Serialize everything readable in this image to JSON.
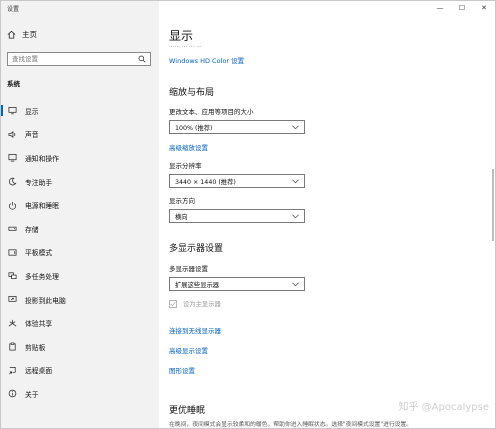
{
  "window": {
    "title": "设置",
    "controls": {
      "minimize": "—",
      "maximize": "☐",
      "close": "✕"
    }
  },
  "sidebar": {
    "home_label": "主页",
    "search_placeholder": "查找设置",
    "section_label": "系统",
    "items": [
      {
        "label": "显示",
        "icon": "monitor-icon"
      },
      {
        "label": "声音",
        "icon": "speaker-icon"
      },
      {
        "label": "通知和操作",
        "icon": "notification-icon"
      },
      {
        "label": "专注助手",
        "icon": "moon-icon"
      },
      {
        "label": "电源和睡眠",
        "icon": "power-icon"
      },
      {
        "label": "存储",
        "icon": "storage-icon"
      },
      {
        "label": "平板模式",
        "icon": "tablet-icon"
      },
      {
        "label": "多任务处理",
        "icon": "multitask-icon"
      },
      {
        "label": "投影到此电脑",
        "icon": "project-icon"
      },
      {
        "label": "体验共享",
        "icon": "share-icon"
      },
      {
        "label": "剪贴板",
        "icon": "clipboard-icon"
      },
      {
        "label": "远程桌面",
        "icon": "remote-desktop-icon"
      },
      {
        "label": "关于",
        "icon": "info-icon"
      }
    ]
  },
  "main": {
    "title": "显示",
    "faded_text": "…… …  …   …",
    "hd_color_link": "Windows HD Color 设置",
    "scale_heading": "缩放与布局",
    "scale_label": "更改文本、应用等项目的大小",
    "scale_value": "100% (推荐)",
    "advanced_scale_link": "高级缩放设置",
    "resolution_label": "显示分辨率",
    "resolution_value": "3440 × 1440 (推荐)",
    "orientation_label": "显示方向",
    "orientation_value": "横向",
    "multi_heading": "多显示器设置",
    "multi_label": "多显示器设置",
    "multi_value": "扩展这些显示器",
    "primary_checkbox_label": "设为主显示器",
    "wireless_link": "连接到无线显示器",
    "advanced_display_link": "高级显示设置",
    "graphics_link": "图形设置",
    "sleep_heading": "更优睡眠",
    "sleep_text": "在晚间，夜间模式会显示较柔和的暖色，帮助你进入睡眠状态。选择\"夜间模式设置\"进行设置。"
  },
  "watermark": "知乎 @Apocalypse",
  "colors": {
    "accent": "#0067c0",
    "sidebar_bg": "#f2f2f2"
  }
}
